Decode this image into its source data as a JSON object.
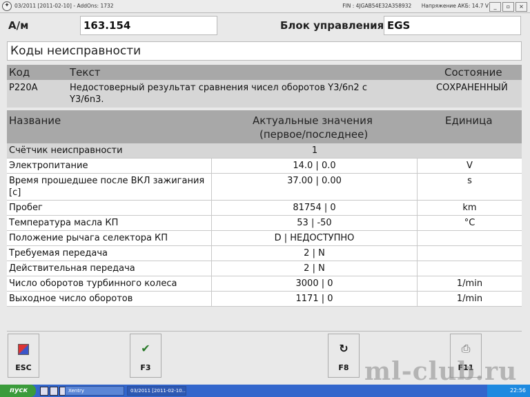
{
  "titlebar": {
    "title": "03/2011 [2011-02-10] - AddOns: 1732",
    "fin": "FIN : 4JGAB54E32A358932",
    "voltage": "Напряжение АКБ: 14.7 V",
    "min": "_",
    "max": "▫",
    "close": "×"
  },
  "header": {
    "am_label": "А/м",
    "am_value": "163.154",
    "block_label": "Блок управления",
    "block_value": "EGS"
  },
  "section_title": "Коды неисправности",
  "faults": {
    "headers": {
      "code": "Код",
      "text": "Текст",
      "status": "Состояние"
    },
    "rows": [
      {
        "code": "P220A",
        "text_line1": "Недостоверный результат сравнения чисел оборотов Y3/6n2 с",
        "text_line2": "Y3/6n3.",
        "status": "СОХРАНЕННЫЙ"
      }
    ]
  },
  "values": {
    "headers": {
      "name": "Название",
      "actual_line1": "Актуальные значения",
      "actual_line2": "(первое/последнее)",
      "unit": "Единица"
    },
    "rows": [
      {
        "name": "Счётчик неисправности",
        "value": "1",
        "unit": ""
      },
      {
        "name": "Электропитание",
        "value": "14.0 |  0.0",
        "unit": "V"
      },
      {
        "name": "Время прошедшее после ВКЛ зажигания [c]",
        "value": "37.00 | 0.00",
        "unit": "s"
      },
      {
        "name": "Пробег",
        "value": "81754 | 0",
        "unit": "km"
      },
      {
        "name": "Температура масла КП",
        "value": "53 | -50",
        "unit": "°C"
      },
      {
        "name": "Положение рычага селектора КП",
        "value": "D | НЕДОСТУПНО",
        "unit": ""
      },
      {
        "name": "Требуемая передача",
        "value": "2 | N",
        "unit": ""
      },
      {
        "name": "Действительная передача",
        "value": "2 | N",
        "unit": ""
      },
      {
        "name": "Число оборотов турбинного колеса",
        "value": "3000 | 0",
        "unit": "1/min"
      },
      {
        "name": "Выходное число оборотов",
        "value": "1171 | 0",
        "unit": "1/min"
      }
    ]
  },
  "buttons": {
    "esc": "ESC",
    "f3": "F3",
    "f8": "F8",
    "f11": "F11"
  },
  "icons": {
    "esc": "exit-door-icon",
    "f3": "checkmark-icon",
    "f8": "refresh-icon",
    "f11": "printer-icon"
  },
  "watermark": "ml-club.ru",
  "taskbar": {
    "start": "пуск",
    "task1": "Xentry",
    "task2": "03/2011 [2011-02-10...",
    "clock": "22:56"
  }
}
